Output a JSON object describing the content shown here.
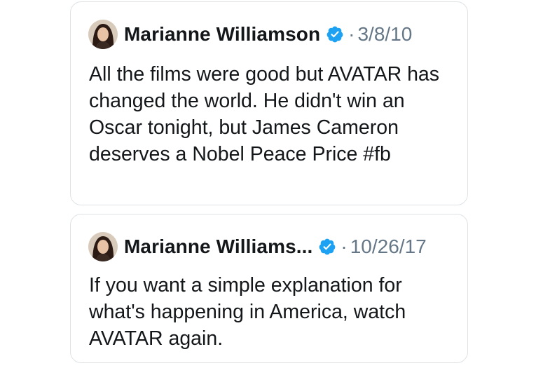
{
  "tweets": [
    {
      "author": "Marianne Williamson",
      "separator": "·",
      "date": "3/8/10",
      "text": "All the films were good but AVATAR has changed the world. He didn't win an Oscar tonight, but James Cameron deserves a Nobel Peace Price #fb",
      "verified_icon": "verified-badge-icon",
      "verified_color": "#1da1f2"
    },
    {
      "author": "Marianne Williams...",
      "separator": "·",
      "date": "10/26/17",
      "text": "If you want a simple explanation for what's happening in America, watch AVATAR again.",
      "verified_icon": "verified-badge-icon",
      "verified_color": "#1da1f2"
    }
  ],
  "colors": {
    "text": "#14171a",
    "muted": "#657786",
    "border": "#dfe3e6",
    "verified": "#1da1f2"
  }
}
